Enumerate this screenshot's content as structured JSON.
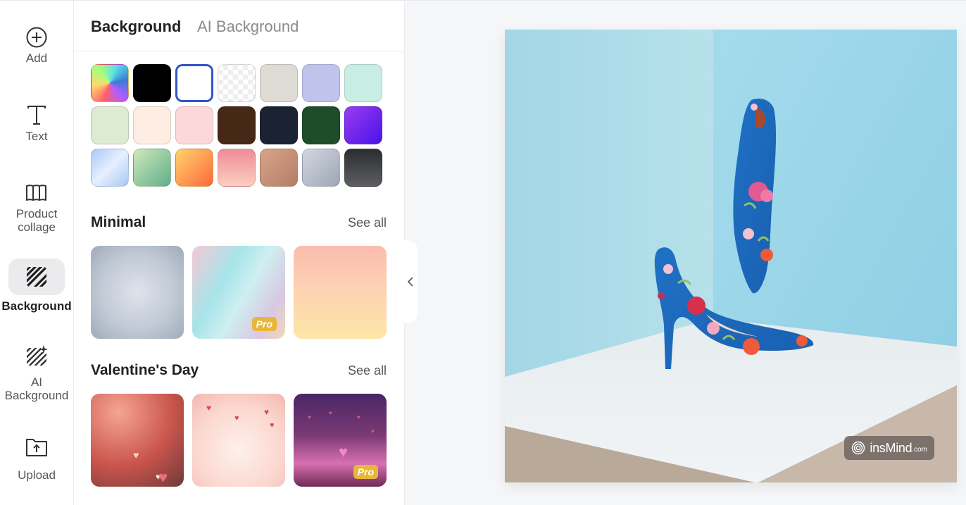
{
  "rail": {
    "items": [
      {
        "label": "Add",
        "icon": "add-circle-icon"
      },
      {
        "label": "Text",
        "icon": "text-icon"
      },
      {
        "label": "Product\ncollage",
        "icon": "collage-icon"
      },
      {
        "label": "Background",
        "icon": "background-icon",
        "active": true
      },
      {
        "label": "AI\nBackground",
        "icon": "ai-background-icon"
      },
      {
        "label": "Upload",
        "icon": "upload-icon"
      }
    ]
  },
  "panel": {
    "tabs": [
      {
        "label": "Background",
        "active": true
      },
      {
        "label": "AI Background",
        "active": false
      }
    ],
    "swatches": [
      {
        "name": "rainbow",
        "fill": "conic-gradient(from 200deg at 50% 50%, #ff5f6d, #ffd86f, #a8ff78, #5ce1e6, #3a7bd5, #b35cff, #ff5f6d)"
      },
      {
        "name": "black",
        "fill": "#000000"
      },
      {
        "name": "white",
        "fill": "#ffffff",
        "selected": true
      },
      {
        "name": "transparent",
        "fill": "repeating-conic-gradient(#eeeeee 0 25%, #ffffff 0 50%) 0 0/14px 14px"
      },
      {
        "name": "warm-gray",
        "fill": "#dedbd4"
      },
      {
        "name": "lavender",
        "fill": "#c0c4ec"
      },
      {
        "name": "mint",
        "fill": "#c8eee4"
      },
      {
        "name": "pale-green",
        "fill": "#dcebd2"
      },
      {
        "name": "peach",
        "fill": "#fdede3"
      },
      {
        "name": "pink",
        "fill": "#fdd8da"
      },
      {
        "name": "brown",
        "fill": "#472716"
      },
      {
        "name": "navy",
        "fill": "#1b2333"
      },
      {
        "name": "forest",
        "fill": "#1e4d2b"
      },
      {
        "name": "purple",
        "fill": "linear-gradient(135deg, #9b3cf0, #4a12e8)"
      },
      {
        "name": "sky-gradient",
        "fill": "linear-gradient(135deg, #a9c8f8, #e6f0ff 50%, #a7c6f4)"
      },
      {
        "name": "green-gradient",
        "fill": "linear-gradient(135deg, #cfe9b9, #5fae8b)"
      },
      {
        "name": "orange-gradient",
        "fill": "linear-gradient(135deg, #ffd26e, #fb6a3a)"
      },
      {
        "name": "rose-gradient",
        "fill": "linear-gradient(180deg, #ee8c97, #fbcfbf)"
      },
      {
        "name": "tan-gradient",
        "fill": "linear-gradient(135deg, #d9a588, #b37d68)"
      },
      {
        "name": "silver-gradient",
        "fill": "linear-gradient(135deg, #d2d7e0, #9ea6b4)"
      },
      {
        "name": "charcoal-gradient",
        "fill": "linear-gradient(180deg, #2c2d30, #5c5e62)"
      }
    ],
    "sections": [
      {
        "title": "Minimal",
        "see_all": "See all",
        "items": [
          {
            "name": "minimal-gray",
            "fill": "radial-gradient(circle at 50% 50%, #dfe3ec 0%, #c2cad6 55%, #9fabba 100%)",
            "pro": false
          },
          {
            "name": "minimal-pastel",
            "fill": "linear-gradient(120deg, #f3c9d4 0%, #a7e4ea 35%, #cfeff0 55%, #d8c8e4 80%, #f4d6b6 100%)",
            "pro": true
          },
          {
            "name": "minimal-peach",
            "fill": "linear-gradient(180deg, #fcbcaf 0%, #fdd3b2 50%, #fde6a6 100%)",
            "pro": false
          }
        ]
      },
      {
        "title": "Valentine's Day",
        "see_all": "See all",
        "items": [
          {
            "name": "valentine-red-bokeh",
            "fill": "radial-gradient(circle at 30% 20%, #f6a493, #c9544c 55%, #6e3a3a 100%)",
            "pro": false
          },
          {
            "name": "valentine-pink-hearts",
            "fill": "radial-gradient(circle at 50% 60%, #fff0ec, #fbd7cf 60%, #f3b7ae 100%)",
            "pro": false
          },
          {
            "name": "valentine-purple-stage",
            "fill": "linear-gradient(180deg, #4a2666 0%, #7b3a74 45%, #d770b2 75%, #6e2a55 100%)",
            "pro": true
          }
        ]
      }
    ],
    "pro_label": "Pro"
  },
  "canvas": {
    "description": "Blue floral high-heel shoes in a pastel blue corner on a white pedestal",
    "watermark": {
      "brand": "insMind",
      "domain": ".com"
    }
  },
  "colors": {
    "accent": "#2f55c9",
    "pro_badge": "#e9b63c",
    "wall_left": "#aedde8",
    "wall_right": "#97d2e6",
    "pedestal": "#e8eef1",
    "floor": "#c2b3a5"
  }
}
